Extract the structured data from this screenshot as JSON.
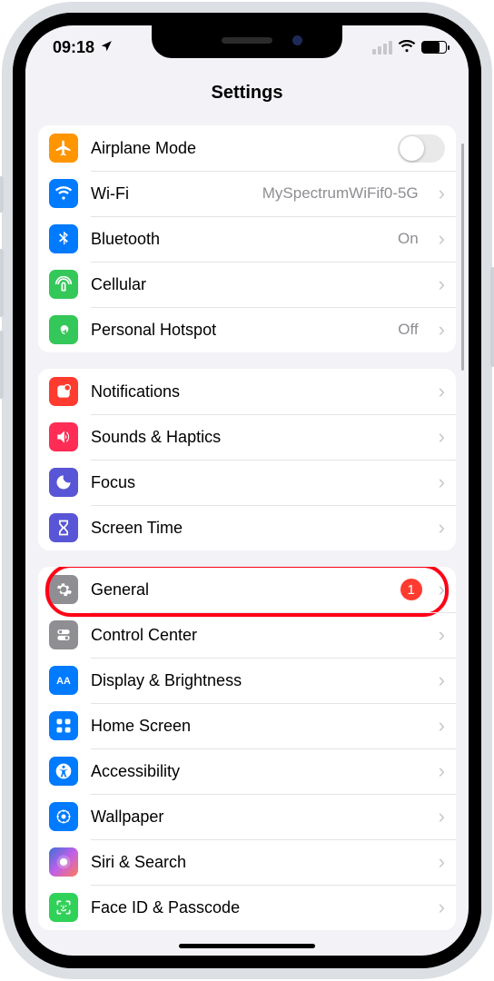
{
  "status": {
    "time": "09:18"
  },
  "title": "Settings",
  "groups": [
    {
      "rows": [
        {
          "icon": "airplane",
          "label": "Airplane Mode",
          "trailing": "switch"
        },
        {
          "icon": "wifi",
          "label": "Wi-Fi",
          "value": "MySpectrumWiFif0-5G",
          "trailing": "chevron"
        },
        {
          "icon": "bluetooth",
          "label": "Bluetooth",
          "value": "On",
          "trailing": "chevron"
        },
        {
          "icon": "cellular",
          "label": "Cellular",
          "trailing": "chevron"
        },
        {
          "icon": "hotspot",
          "label": "Personal Hotspot",
          "value": "Off",
          "trailing": "chevron"
        }
      ]
    },
    {
      "rows": [
        {
          "icon": "notifications",
          "label": "Notifications",
          "trailing": "chevron"
        },
        {
          "icon": "sounds",
          "label": "Sounds & Haptics",
          "trailing": "chevron"
        },
        {
          "icon": "focus",
          "label": "Focus",
          "trailing": "chevron"
        },
        {
          "icon": "screentime",
          "label": "Screen Time",
          "trailing": "chevron"
        }
      ]
    },
    {
      "rows": [
        {
          "icon": "general",
          "label": "General",
          "badge": "1",
          "trailing": "chevron",
          "highlighted": true
        },
        {
          "icon": "controlcenter",
          "label": "Control Center",
          "trailing": "chevron"
        },
        {
          "icon": "display",
          "label": "Display & Brightness",
          "trailing": "chevron"
        },
        {
          "icon": "homescreen",
          "label": "Home Screen",
          "trailing": "chevron"
        },
        {
          "icon": "accessibility",
          "label": "Accessibility",
          "trailing": "chevron"
        },
        {
          "icon": "wallpaper",
          "label": "Wallpaper",
          "trailing": "chevron"
        },
        {
          "icon": "siri",
          "label": "Siri & Search",
          "trailing": "chevron"
        },
        {
          "icon": "faceid",
          "label": "Face ID & Passcode",
          "trailing": "chevron"
        }
      ]
    }
  ],
  "iconStyle": {
    "airplane": "c-orange",
    "wifi": "c-blue",
    "bluetooth": "c-blue",
    "cellular": "c-green",
    "hotspot": "c-green",
    "notifications": "c-red",
    "sounds": "c-pink",
    "focus": "c-indigo",
    "screentime": "c-indigo",
    "general": "c-grey",
    "controlcenter": "c-grey",
    "display": "c-blue",
    "homescreen": "c-blue",
    "accessibility": "c-blue",
    "wallpaper": "c-blue",
    "siri": "siri-grad",
    "faceid": "c-lime"
  }
}
